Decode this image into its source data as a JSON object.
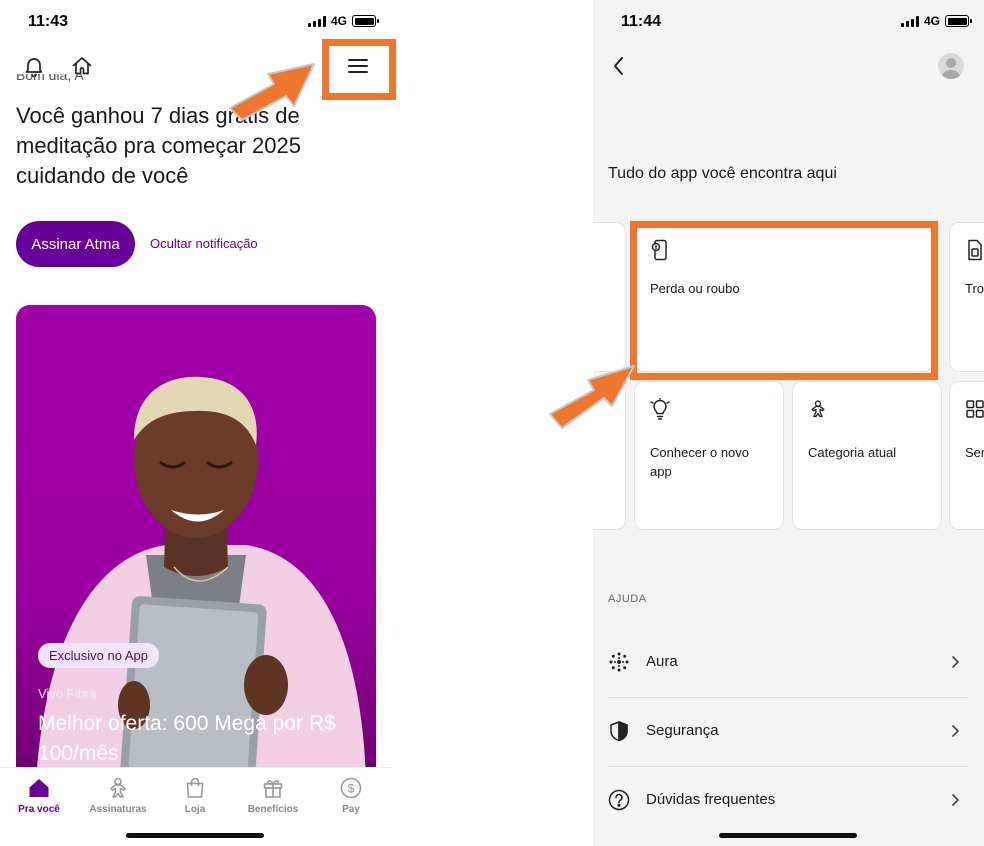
{
  "left": {
    "status": {
      "time": "11:43",
      "network": "4G"
    },
    "header_icons": [
      "bell-icon",
      "home-icon",
      "hamburger-menu-icon"
    ],
    "greeting_partial": "Bom dia, A",
    "headline": "Você ganhou 7 dias grátis de meditação pra começar 2025 cuidando de você",
    "cta_label": "Assinar Atma",
    "hide_link": "Ocultar notificação",
    "hero": {
      "badge": "Exclusivo no App",
      "subtitle": "Vivo Fibra",
      "title": "Melhor oferta: 600 Mega por R$ 100/mês"
    },
    "tabs": [
      {
        "label": "Pra você",
        "icon": "home-filled-icon",
        "active": true
      },
      {
        "label": "Assinaturas",
        "icon": "gingerbread-icon",
        "active": false
      },
      {
        "label": "Loja",
        "icon": "shopping-bag-icon",
        "active": false
      },
      {
        "label": "Benefícios",
        "icon": "gift-icon",
        "active": false
      },
      {
        "label": "Pay",
        "icon": "dollar-circle-icon",
        "active": false
      }
    ]
  },
  "right": {
    "status": {
      "time": "11:44",
      "network": "4G"
    },
    "section_title": "Tudo do app você encontra aqui",
    "cards": [
      {
        "label": "Perda ou roubo",
        "icon": "phone-lost-icon"
      },
      {
        "label": "Tro",
        "icon": "sim-card-icon"
      },
      {
        "label": "Conhecer o novo app",
        "icon": "lightbulb-icon"
      },
      {
        "label": "Categoria atual",
        "icon": "gingerbread-icon"
      },
      {
        "label": "Ser",
        "icon": "grid-icon"
      }
    ],
    "help_section_label": "AJUDA",
    "help_items": [
      {
        "label": "Aura",
        "icon": "dots-circle-icon"
      },
      {
        "label": "Segurança",
        "icon": "shield-icon"
      },
      {
        "label": "Dúvidas frequentes",
        "icon": "question-circle-icon"
      }
    ]
  },
  "colors": {
    "brand_purple": "#660099",
    "annotation_orange": "#ee7630",
    "hero_purple": "#9b00a0",
    "right_bg": "#f4f4f4"
  }
}
